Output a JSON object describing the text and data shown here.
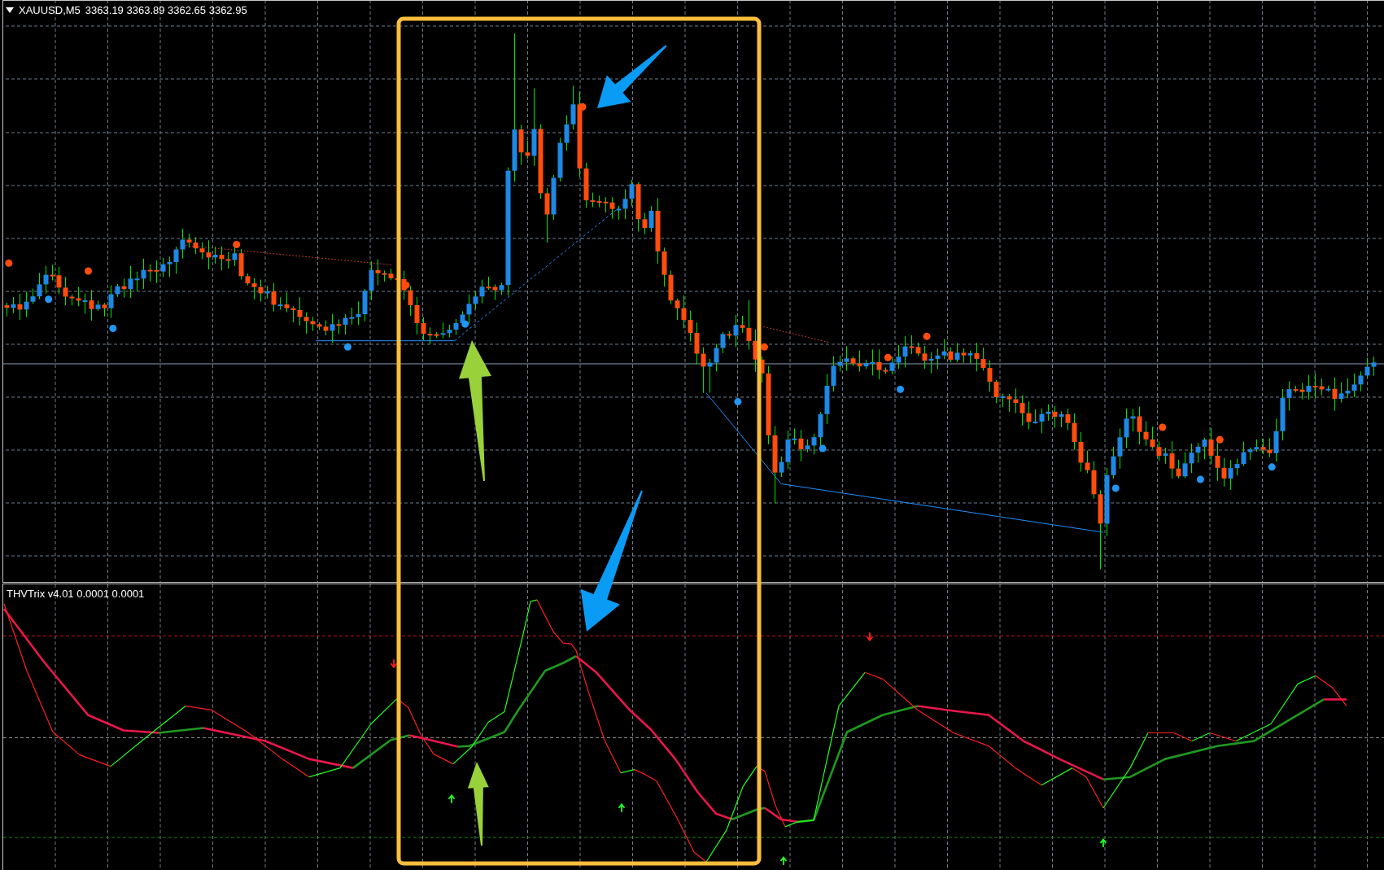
{
  "price_chart": {
    "symbol": "XAUUSD,M5",
    "ohlc": "3363.19 3363.89 3362.65 3362.95"
  },
  "indicator": {
    "label": "THVTrix v4.01 0.0001 0.0001"
  }
}
